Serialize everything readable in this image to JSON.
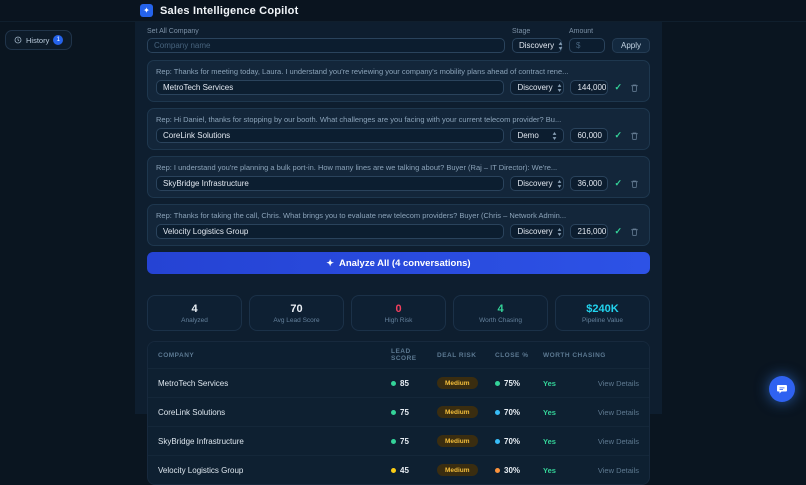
{
  "header": {
    "title": "Sales Intelligence Copilot",
    "app_icon_glyph": "✦"
  },
  "history": {
    "label": "History",
    "badge": "1"
  },
  "bulk_bar": {
    "company_label": "Set All Company",
    "company_placeholder": "Company name",
    "stage_label": "Stage",
    "stage_value": "Discovery",
    "amount_label": "Amount",
    "amount_placeholder": "$",
    "apply_label": "Apply"
  },
  "conversations": [
    {
      "rep_text": "Rep: Thanks for meeting today, Laura. I understand you're reviewing your company's mobility plans ahead of contract rene...",
      "company": "MetroTech Services",
      "stage": "Discovery",
      "amount": "144,000",
      "check_glyph": "✓"
    },
    {
      "rep_text": "Rep: Hi Daniel, thanks for stopping by our booth. What challenges are you facing with your current telecom provider? Bu...",
      "company": "CoreLink Solutions",
      "stage": "Demo",
      "amount": "60,000",
      "check_glyph": "✓"
    },
    {
      "rep_text": "Rep: I understand you're planning a bulk port-in. How many lines are we talking about? Buyer (Raj – IT Director): We're...",
      "company": "SkyBridge Infrastructure",
      "stage": "Discovery",
      "amount": "36,000",
      "check_glyph": "✓"
    },
    {
      "rep_text": "Rep: Thanks for taking the call, Chris. What brings you to evaluate new telecom providers? Buyer (Chris – Network Admin...",
      "company": "Velocity Logistics Group",
      "stage": "Discovery",
      "amount": "216,000",
      "check_glyph": "✓"
    }
  ],
  "analyze": {
    "label": "Analyze All (4 conversations)",
    "sparkle_glyph": "✦"
  },
  "stats": [
    {
      "value": "4",
      "label": "Analyzed",
      "color": "#e9eef4"
    },
    {
      "value": "70",
      "label": "Avg Lead Score",
      "color": "#e9eef4"
    },
    {
      "value": "0",
      "label": "High Risk",
      "color": "#f43f5e"
    },
    {
      "value": "4",
      "label": "Worth Chasing",
      "color": "#34d399"
    },
    {
      "value": "$240K",
      "label": "Pipeline Value",
      "color": "#22d3ee"
    }
  ],
  "table": {
    "columns": {
      "company": "COMPANY",
      "lead_score": "LEAD SCORE",
      "deal_risk": "DEAL RISK",
      "close_pct": "CLOSE %",
      "worth_chasing": "WORTH CHASING"
    },
    "rows": [
      {
        "company": "MetroTech Services",
        "lead_score": "85",
        "lead_dot": "#34d399",
        "deal_risk": "Medium",
        "close_pct": "75%",
        "close_dot": "#34d399",
        "worth_chasing": "Yes",
        "action": "View Details"
      },
      {
        "company": "CoreLink Solutions",
        "lead_score": "75",
        "lead_dot": "#34d399",
        "deal_risk": "Medium",
        "close_pct": "70%",
        "close_dot": "#38bdf8",
        "worth_chasing": "Yes",
        "action": "View Details"
      },
      {
        "company": "SkyBridge Infrastructure",
        "lead_score": "75",
        "lead_dot": "#34d399",
        "deal_risk": "Medium",
        "close_pct": "70%",
        "close_dot": "#38bdf8",
        "worth_chasing": "Yes",
        "action": "View Details"
      },
      {
        "company": "Velocity Logistics Group",
        "lead_score": "45",
        "lead_dot": "#facc15",
        "deal_risk": "Medium",
        "close_pct": "30%",
        "close_dot": "#fb923c",
        "worth_chasing": "Yes",
        "action": "View Details"
      }
    ]
  }
}
